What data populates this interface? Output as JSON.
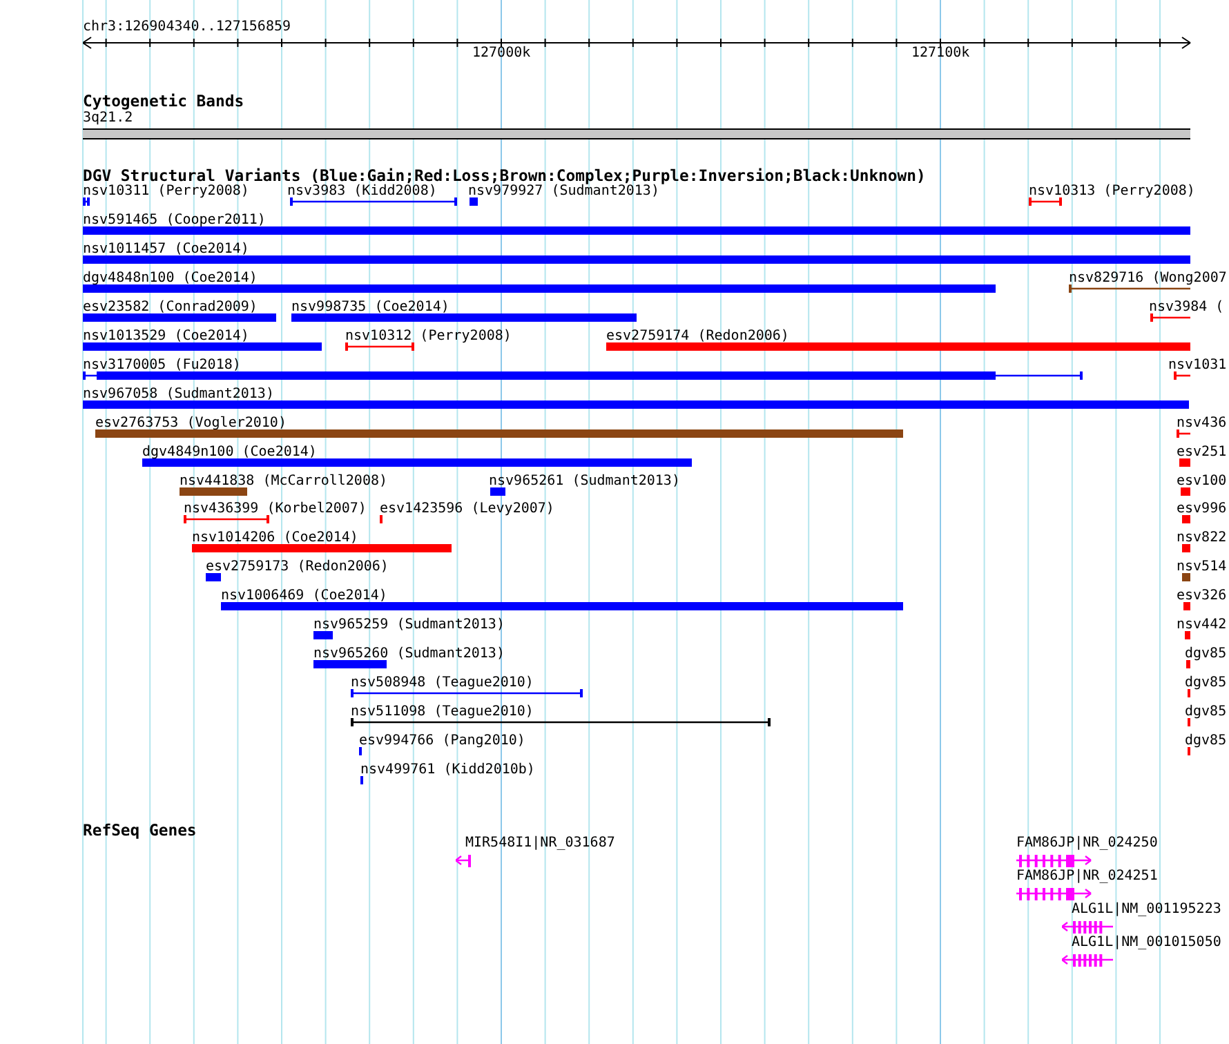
{
  "ruler": {
    "region": "chr3:126904340..127156859",
    "ticks": [
      {
        "label": "127000k"
      },
      {
        "label": "127100k"
      }
    ]
  },
  "cytobands": {
    "title": "Cytogenetic Bands",
    "bands": [
      {
        "name": "3q21.2"
      }
    ]
  },
  "variants": {
    "title": "DGV Structural Variants (Blue:Gain;Red:Loss;Brown:Complex;Purple:Inversion;Black:Unknown)",
    "features": [
      {
        "label": "nsv10311 (Perry2008)",
        "kind": "line",
        "color": "#0000ff"
      },
      {
        "label": "nsv3983 (Kidd2008)",
        "kind": "line",
        "color": "#0000ff"
      },
      {
        "label": "nsv979927 (Sudmant2013)",
        "kind": "box",
        "color": "#0000ff"
      },
      {
        "label": "nsv10313 (Perry2008)",
        "kind": "line",
        "color": "#ff0000"
      },
      {
        "label": "nsv591465 (Cooper2011)",
        "kind": "box",
        "color": "#0000ff"
      },
      {
        "label": "nsv1011457 (Coe2014)",
        "kind": "box",
        "color": "#0000ff"
      },
      {
        "label": "dgv4848n100 (Coe2014)",
        "kind": "box",
        "color": "#0000ff"
      },
      {
        "label": "nsv829716 (Wong2007",
        "kind": "line",
        "color": "#8b4513"
      },
      {
        "label": "esv23582 (Conrad2009)",
        "kind": "box",
        "color": "#0000ff"
      },
      {
        "label": "nsv998735 (Coe2014)",
        "kind": "box",
        "color": "#0000ff"
      },
      {
        "label": "nsv3984 (",
        "kind": "line",
        "color": "#ff0000"
      },
      {
        "label": "nsv1013529 (Coe2014)",
        "kind": "box",
        "color": "#0000ff"
      },
      {
        "label": "nsv10312 (Perry2008)",
        "kind": "line",
        "color": "#ff0000"
      },
      {
        "label": "esv2759174 (Redon2006)",
        "kind": "box",
        "color": "#ff0000"
      },
      {
        "label": "nsv3170005 (Fu2018)",
        "kind": "boxline",
        "color": "#0000ff"
      },
      {
        "label": "nsv1031",
        "kind": "line",
        "color": "#ff0000"
      },
      {
        "label": "nsv967058 (Sudmant2013)",
        "kind": "box",
        "color": "#0000ff"
      },
      {
        "label": "esv2763753 (Vogler2010)",
        "kind": "box",
        "color": "#8b4513"
      },
      {
        "label": "nsv436",
        "kind": "line",
        "color": "#ff0000"
      },
      {
        "label": "dgv4849n100 (Coe2014)",
        "kind": "box",
        "color": "#0000ff"
      },
      {
        "label": "esv251",
        "kind": "box",
        "color": "#ff0000"
      },
      {
        "label": "nsv441838 (McCarroll2008)",
        "kind": "box",
        "color": "#8b4513"
      },
      {
        "label": "nsv965261 (Sudmant2013)",
        "kind": "box",
        "color": "#0000ff"
      },
      {
        "label": "esv100",
        "kind": "box",
        "color": "#ff0000"
      },
      {
        "label": "nsv436399 (Korbel2007)",
        "kind": "line",
        "color": "#ff0000"
      },
      {
        "label": "esv1423596 (Levy2007)",
        "kind": "box",
        "color": "#ff0000"
      },
      {
        "label": "esv996",
        "kind": "box",
        "color": "#ff0000"
      },
      {
        "label": "nsv1014206 (Coe2014)",
        "kind": "box",
        "color": "#ff0000"
      },
      {
        "label": "nsv822",
        "kind": "box",
        "color": "#ff0000"
      },
      {
        "label": "esv2759173 (Redon2006)",
        "kind": "box",
        "color": "#0000ff"
      },
      {
        "label": "nsv514",
        "kind": "box",
        "color": "#8b4513"
      },
      {
        "label": "nsv1006469 (Coe2014)",
        "kind": "box",
        "color": "#0000ff"
      },
      {
        "label": "esv326",
        "kind": "box",
        "color": "#ff0000"
      },
      {
        "label": "nsv965259 (Sudmant2013)",
        "kind": "box",
        "color": "#0000ff"
      },
      {
        "label": "nsv442",
        "kind": "box",
        "color": "#ff0000"
      },
      {
        "label": "nsv965260 (Sudmant2013)",
        "kind": "box",
        "color": "#0000ff"
      },
      {
        "label": "dgv85",
        "kind": "box",
        "color": "#ff0000"
      },
      {
        "label": "nsv508948 (Teague2010)",
        "kind": "line",
        "color": "#0000ff"
      },
      {
        "label": "dgv85",
        "kind": "box",
        "color": "#ff0000"
      },
      {
        "label": "nsv511098 (Teague2010)",
        "kind": "line",
        "color": "#000000"
      },
      {
        "label": "dgv85",
        "kind": "box",
        "color": "#ff0000"
      },
      {
        "label": "esv994766 (Pang2010)",
        "kind": "box",
        "color": "#0000ff"
      },
      {
        "label": "dgv85",
        "kind": "box",
        "color": "#ff0000"
      },
      {
        "label": "nsv499761 (Kidd2010b)",
        "kind": "box",
        "color": "#0000ff"
      }
    ]
  },
  "genes": {
    "title": "RefSeq Genes",
    "items": [
      {
        "label": "MIR548I1|NR_031687",
        "reverse": true
      },
      {
        "label": "FAM86JP|NR_024250",
        "reverse": false
      },
      {
        "label": "FAM86JP|NR_024251",
        "reverse": false
      },
      {
        "label": "ALG1L|NM_001195223",
        "reverse": true
      },
      {
        "label": "ALG1L|NM_001015050",
        "reverse": true
      }
    ]
  }
}
